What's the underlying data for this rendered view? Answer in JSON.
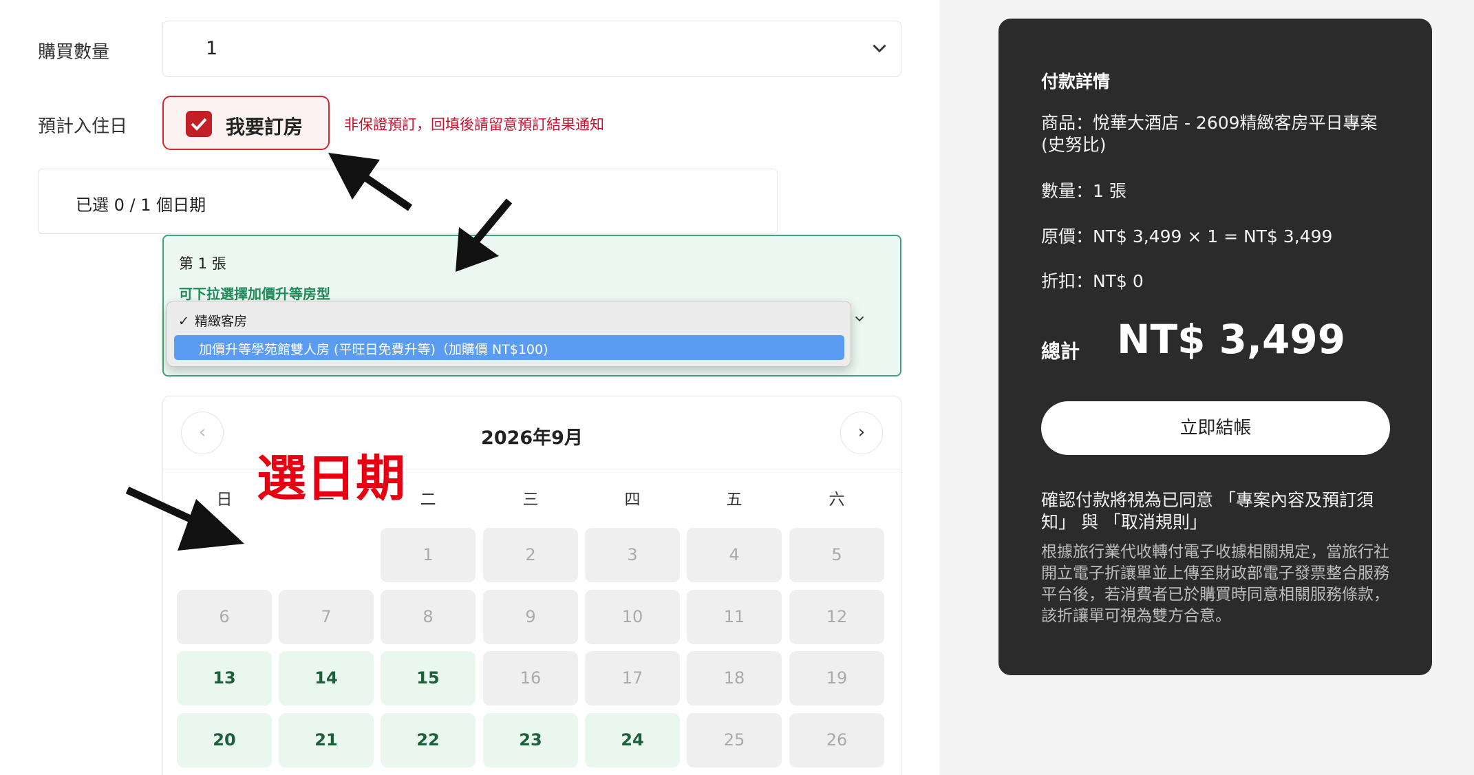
{
  "form": {
    "qty_label": "購買數量",
    "qty_value": "1",
    "checkin_label": "預計入住日",
    "book_checkbox_label": "我要訂房",
    "warning": "非保證預訂，回填後請留意預訂結果通知",
    "selected_dates": "已選 0 / 1 個日期"
  },
  "ticket": {
    "title": "第 1 張",
    "hint": "可下拉選擇加價升等房型",
    "options": [
      "精緻客房",
      "加價升等學苑館雙人房 (平旺日免費升等)（加購價 NT$100)"
    ],
    "selected_option": "精緻客房",
    "checkmark": "✓"
  },
  "calendar": {
    "title": "2026年9月",
    "prev": "‹",
    "next": "›",
    "weekdays": [
      "日",
      "一",
      "二",
      "三",
      "四",
      "五",
      "六"
    ],
    "days": [
      "1",
      "2",
      "3",
      "4",
      "5",
      "6",
      "7",
      "8",
      "9",
      "10",
      "11",
      "12",
      "13",
      "14",
      "15",
      "16",
      "17",
      "18",
      "19",
      "20",
      "21",
      "22",
      "23",
      "24",
      "25",
      "26"
    ],
    "available_days": [
      "13",
      "14",
      "15",
      "20",
      "21",
      "22",
      "23",
      "24"
    ]
  },
  "annotation": {
    "label": "選日期",
    "color": "#e60012"
  },
  "summary": {
    "title": "付款詳情",
    "product": "商品：悅華大酒店 - 2609精緻客房平日專案 (史努比)",
    "quantity": "數量：1 張",
    "price": "原價：NT$ 3,499 × 1 = NT$ 3,499",
    "discount": "折扣：NT$ 0",
    "total_label": "總計",
    "total_value": "NT$ 3,499",
    "checkout_button": "立即結帳",
    "agreement": "確認付款將視為已同意 「專案內容及預訂須知」 與 「取消規則」",
    "note": "根據旅行業代收轉付電子收據相關規定，當旅行社開立電子折讓單並上傳至財政部電子發票整合服務平台後，若消費者已於購買時同意相關服務條款，該折讓單可視為雙方合意。"
  },
  "colors": {
    "accent_red": "#c21f27",
    "green_border": "#3fa57a",
    "available_bg": "#e9f7ee",
    "panel_bg": "#2b2b2b",
    "dropdown_highlight": "#5b9cf3"
  },
  "icons": [
    "chevron-down-icon",
    "checkbox-checked-icon",
    "checkmark-icon",
    "chevron-left-icon",
    "chevron-right-icon",
    "arrow-annotation-icon"
  ]
}
